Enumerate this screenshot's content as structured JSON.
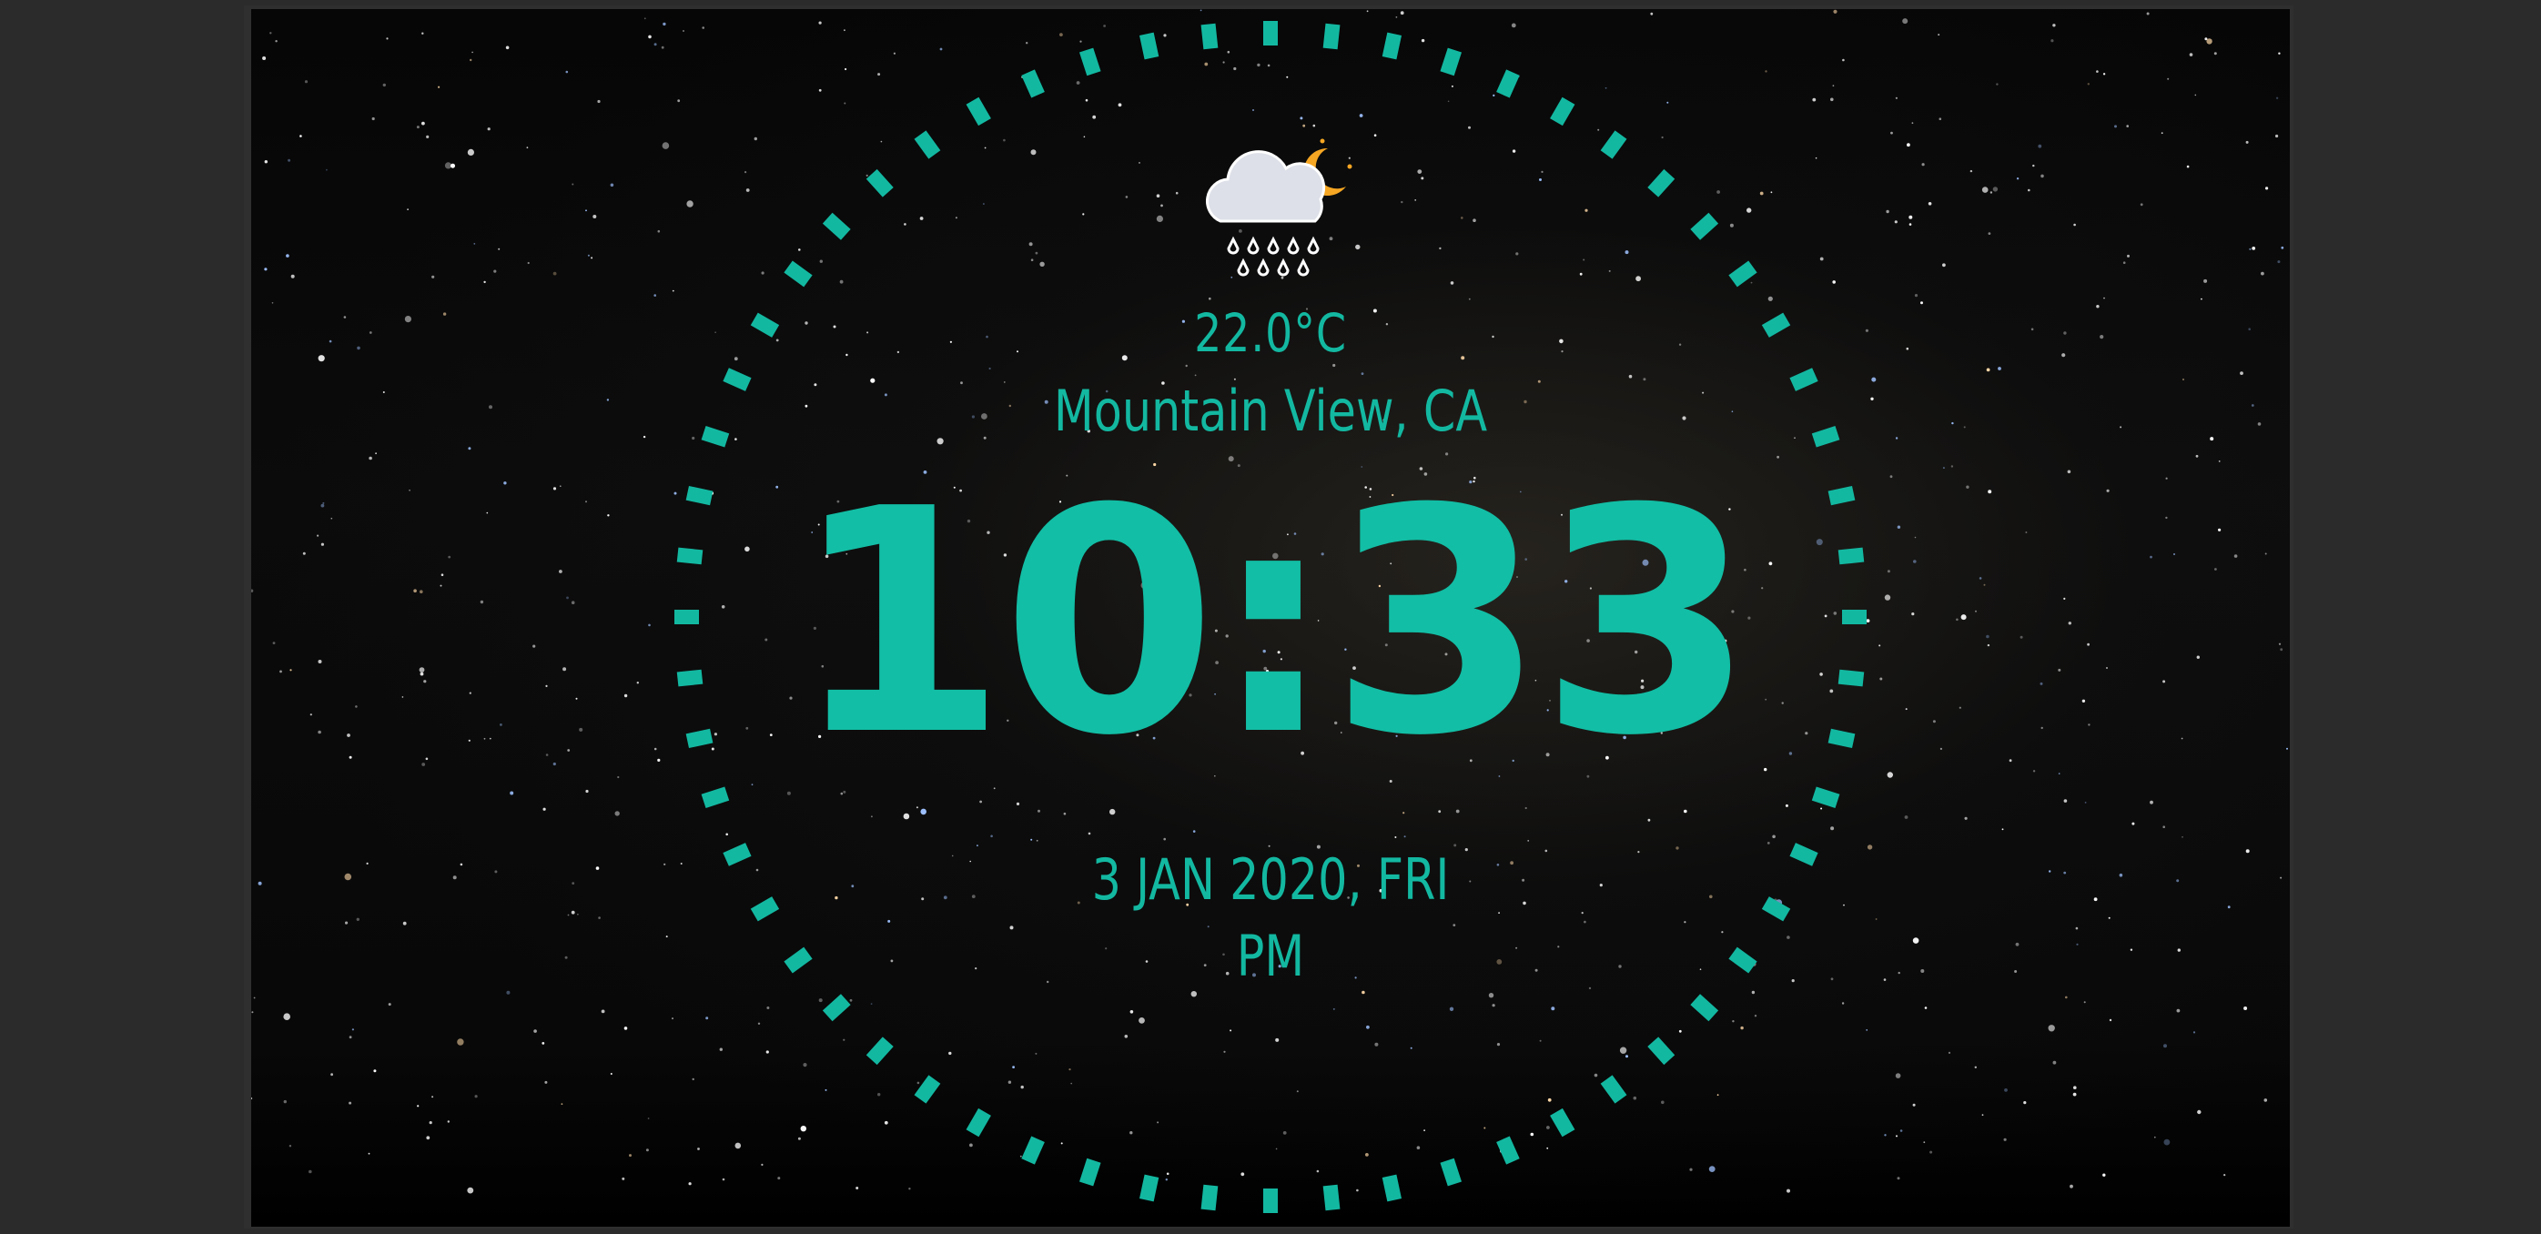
{
  "weather": {
    "icon": "night-rain-icon",
    "temperature": "22.0°C",
    "location": "Mountain View, CA"
  },
  "clock": {
    "time": "10:33",
    "date": "3 JAN 2020, FRI",
    "meridiem": "PM"
  },
  "colors": {
    "accent": "#13b8a1",
    "background": "#070707",
    "bezel": "#2f2f2f",
    "moon": "#f5a623",
    "cloud": "#dde0e8"
  }
}
